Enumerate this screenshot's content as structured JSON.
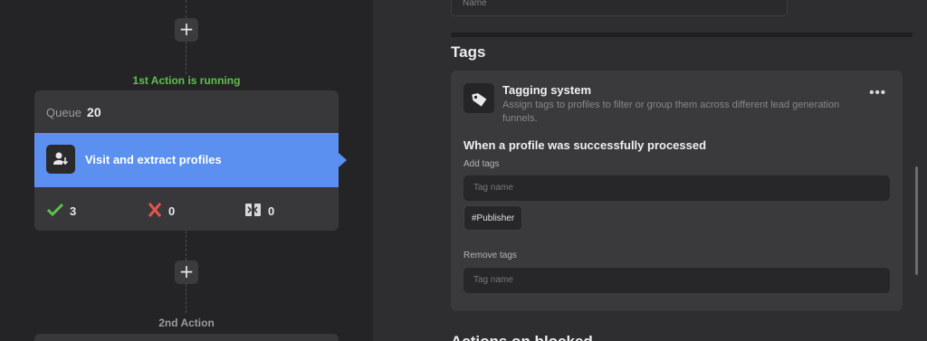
{
  "workflow": {
    "status_label": "1st Action is running",
    "queue_label": "Queue",
    "queue_count": "20",
    "action_label": "Visit and extract profiles",
    "stats": {
      "success": "3",
      "failed": "0",
      "skipped": "0"
    },
    "next_label": "2nd Action",
    "add_symbol": "+"
  },
  "settings": {
    "name_placeholder": "Name",
    "tags_heading": "Tags",
    "tagging": {
      "title": "Tagging system",
      "description": "Assign tags to profiles to filter or group them across different lead generation funnels.",
      "menu": "•••",
      "condition": "When a profile was successfully processed",
      "add_label": "Add tags",
      "add_placeholder": "Tag name",
      "chips": [
        "#Publisher"
      ],
      "remove_label": "Remove tags",
      "remove_placeholder": "Tag name"
    },
    "next_heading": "Actions on blocked..."
  },
  "colors": {
    "accent": "#5b8ff0",
    "success": "#5cc24a",
    "error": "#e5534b"
  }
}
